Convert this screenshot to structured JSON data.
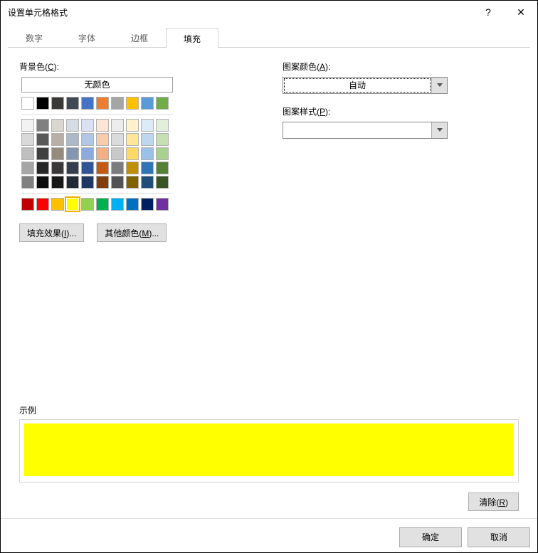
{
  "window": {
    "title": "设置单元格格式"
  },
  "titlebar": {
    "help": "?",
    "close": "✕"
  },
  "tabs": {
    "items": [
      {
        "label": "数字",
        "active": false
      },
      {
        "label": "字体",
        "active": false
      },
      {
        "label": "边框",
        "active": false
      },
      {
        "label": "填充",
        "active": true
      }
    ]
  },
  "fill": {
    "bgcolor_label_prefix": "背景色(",
    "bgcolor_label_ul": "C",
    "bgcolor_label_suffix": "):",
    "no_color": "无颜色",
    "palette_main": [
      [
        "#ffffff",
        "#000000",
        "#3b3838",
        "#404854",
        "#4472c4",
        "#ed7d31",
        "#a5a5a5",
        "#ffc000",
        "#5b9bd5",
        "#70ad47"
      ]
    ],
    "palette_theme": [
      [
        "#f2f2f2",
        "#808080",
        "#dad6d2",
        "#d5dce4",
        "#d9e1f2",
        "#fce4d6",
        "#ededed",
        "#fff2cc",
        "#ddebf7",
        "#e2efda"
      ],
      [
        "#d9d9d9",
        "#595959",
        "#b8b0a8",
        "#acb9ca",
        "#b4c6e7",
        "#f8cbad",
        "#dbdbdb",
        "#ffe699",
        "#bdd7ee",
        "#c6e0b4"
      ],
      [
        "#bfbfbf",
        "#404040",
        "#958b7e",
        "#8497b0",
        "#8ea9db",
        "#f4b084",
        "#c9c9c9",
        "#ffd966",
        "#9bc2e6",
        "#a9d08e"
      ],
      [
        "#a6a6a6",
        "#262626",
        "#3a3838",
        "#333f4f",
        "#305496",
        "#c65911",
        "#7b7b7b",
        "#bf8f00",
        "#2f75b5",
        "#548235"
      ],
      [
        "#808080",
        "#0d0d0d",
        "#171717",
        "#222b35",
        "#203764",
        "#833c0c",
        "#525252",
        "#806000",
        "#1f4e78",
        "#375623"
      ]
    ],
    "palette_standard": [
      [
        "#c00000",
        "#ff0000",
        "#ffc000",
        "#ffff00",
        "#92d050",
        "#00b050",
        "#00b0f0",
        "#0070c0",
        "#002060",
        "#7030a0"
      ]
    ],
    "selected_color": "#ffff00",
    "fill_effects_label": "填充效果(I)...",
    "more_colors_label": "其他颜色(M)...",
    "pattern_color_prefix": "图案颜色(",
    "pattern_color_ul": "A",
    "pattern_color_suffix": "):",
    "pattern_color_value": "自动",
    "pattern_style_prefix": "图案样式(",
    "pattern_style_ul": "P",
    "pattern_style_suffix": "):",
    "pattern_style_value": "",
    "sample_label": "示例",
    "sample_color": "#ffff00",
    "clear_label_prefix": "清除(",
    "clear_label_ul": "R",
    "clear_label_suffix": ")"
  },
  "footer": {
    "ok": "确定",
    "cancel": "取消"
  }
}
